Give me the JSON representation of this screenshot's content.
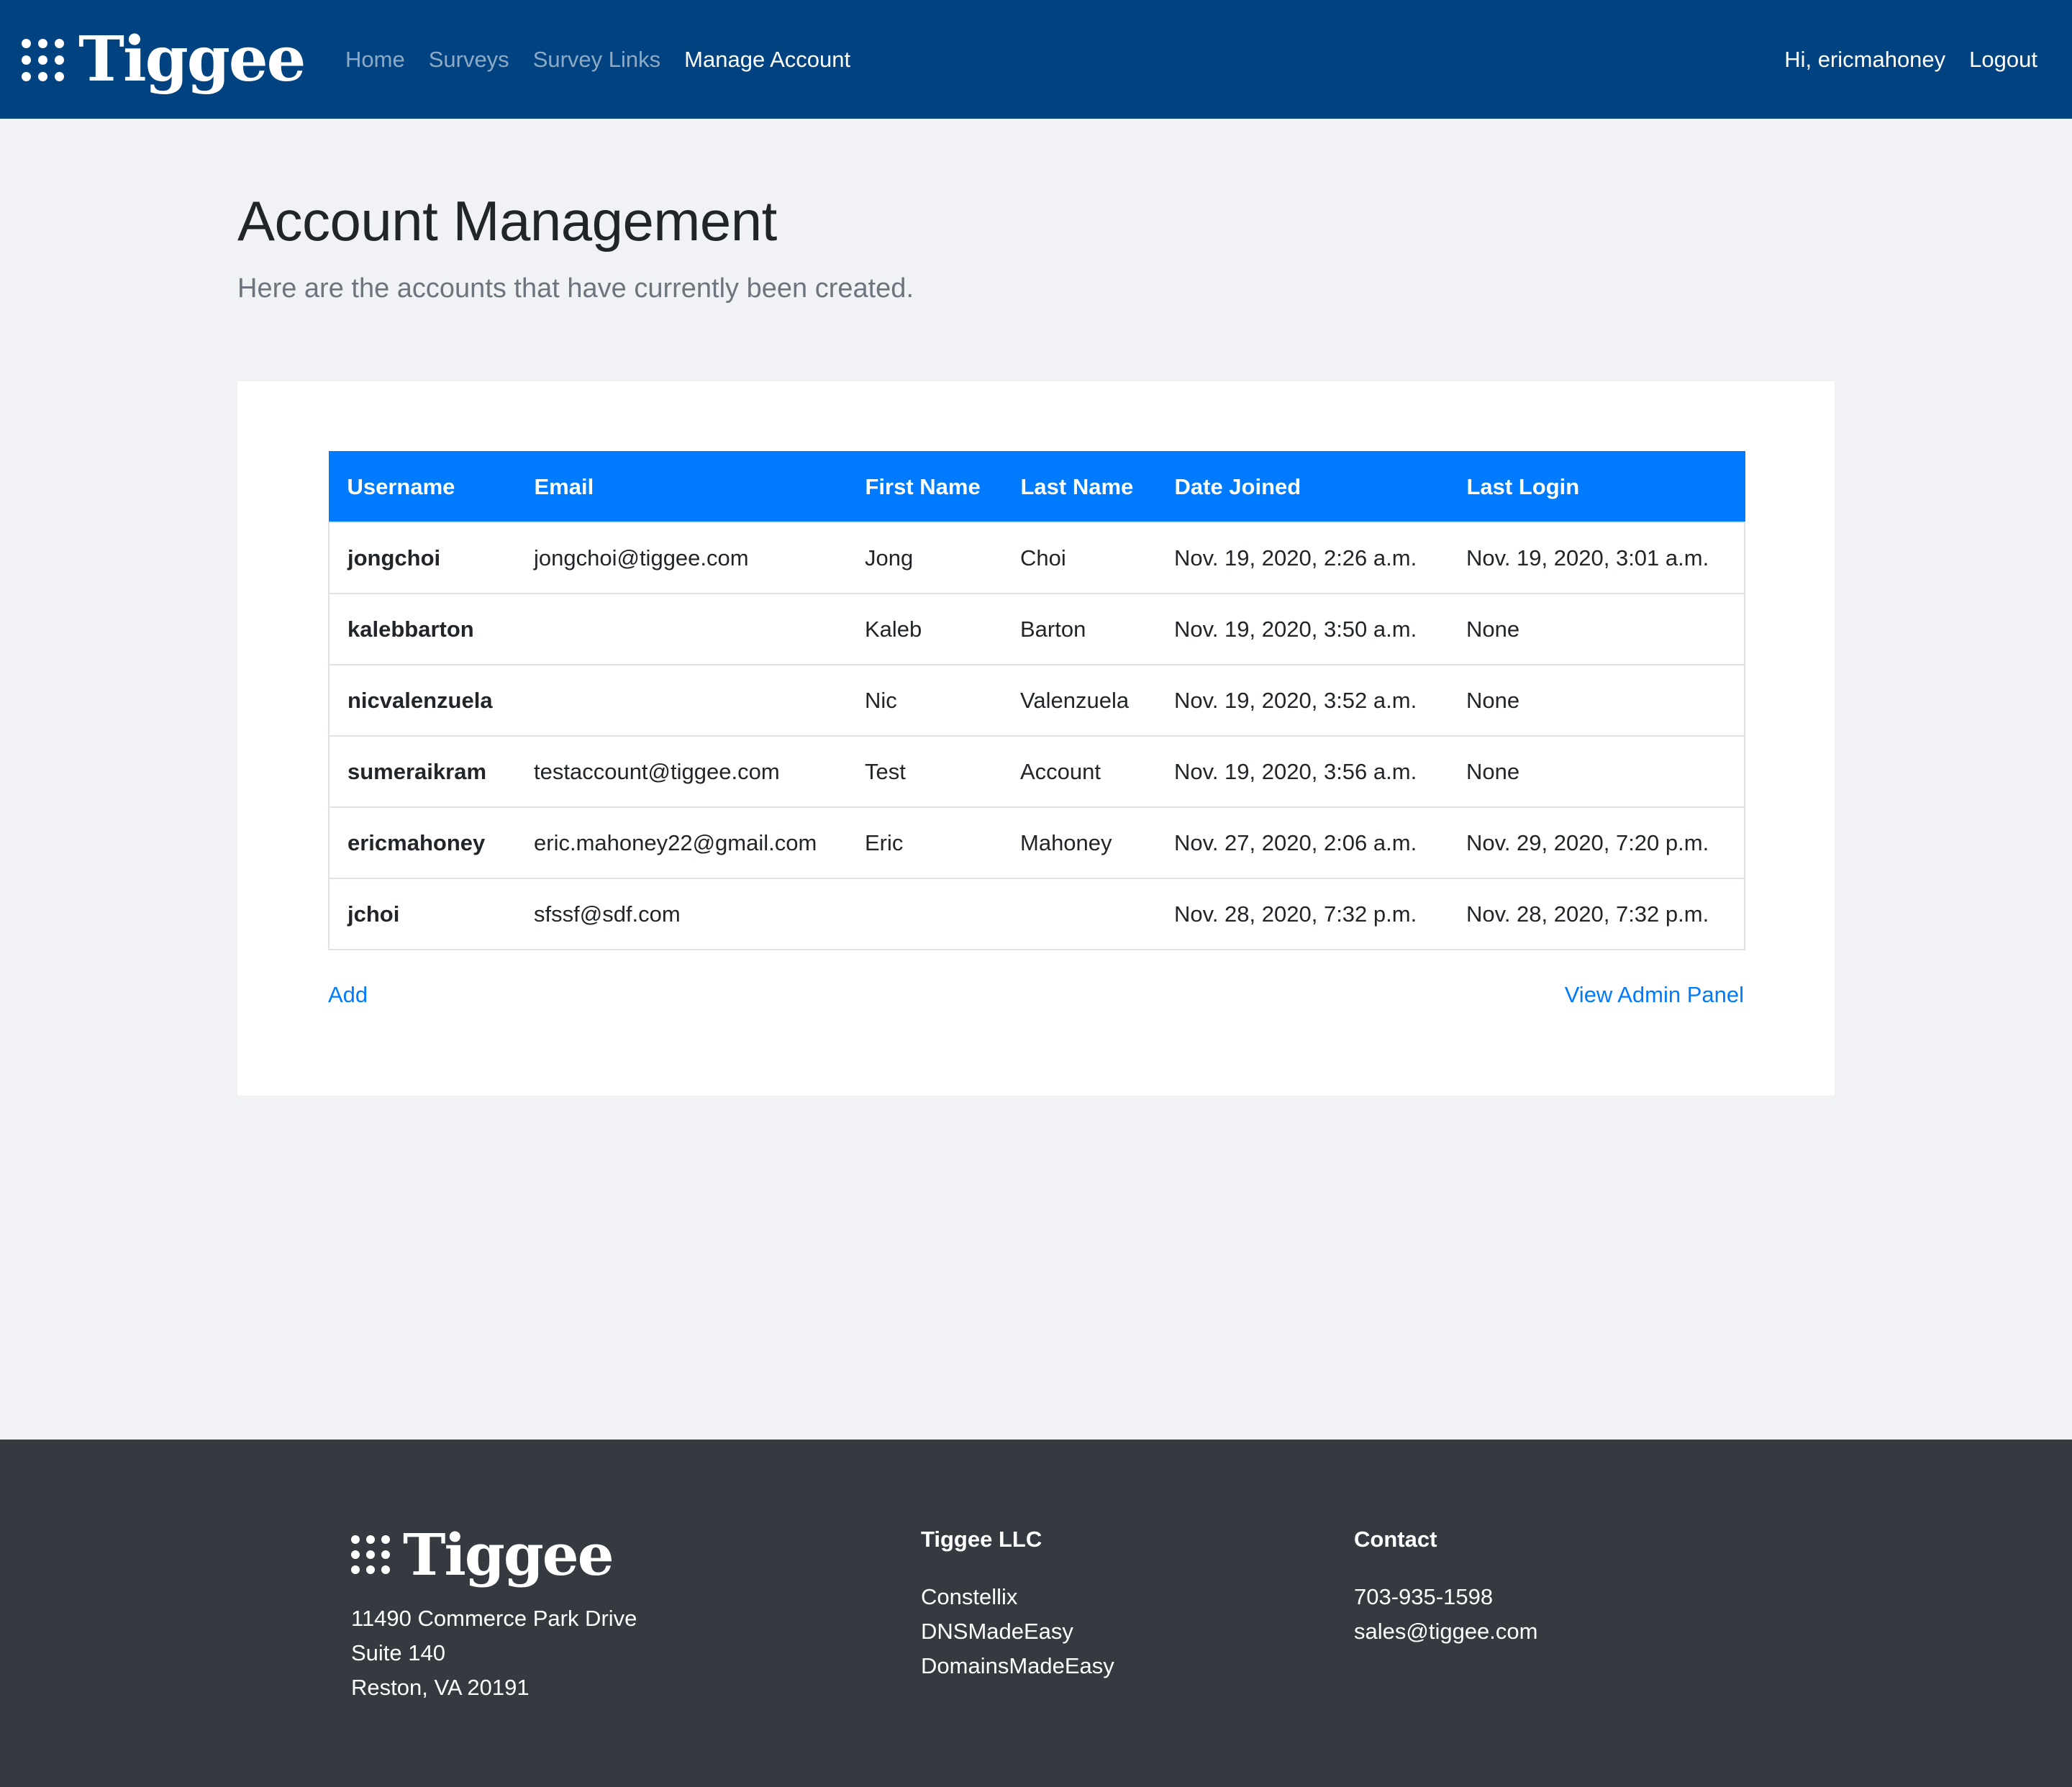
{
  "nav": {
    "brand": "Tiggee",
    "links": [
      {
        "label": "Home"
      },
      {
        "label": "Surveys"
      },
      {
        "label": "Survey Links"
      },
      {
        "label": "Manage Account"
      }
    ],
    "greeting": "Hi, ericmahoney",
    "logout": "Logout"
  },
  "header": {
    "title": "Account Management",
    "lead": "Here are the accounts that have currently been created."
  },
  "table": {
    "columns": [
      "Username",
      "Email",
      "First Name",
      "Last Name",
      "Date Joined",
      "Last Login"
    ],
    "rows": [
      [
        "jongchoi",
        "jongchoi@tiggee.com",
        "Jong",
        "Choi",
        "Nov. 19, 2020, 2:26 a.m.",
        "Nov. 19, 2020, 3:01 a.m."
      ],
      [
        "kalebbarton",
        "",
        "Kaleb",
        "Barton",
        "Nov. 19, 2020, 3:50 a.m.",
        "None"
      ],
      [
        "nicvalenzuela",
        "",
        "Nic",
        "Valenzuela",
        "Nov. 19, 2020, 3:52 a.m.",
        "None"
      ],
      [
        "sumeraikram",
        "testaccount@tiggee.com",
        "Test",
        "Account",
        "Nov. 19, 2020, 3:56 a.m.",
        "None"
      ],
      [
        "ericmahoney",
        "eric.mahoney22@gmail.com",
        "Eric",
        "Mahoney",
        "Nov. 27, 2020, 2:06 a.m.",
        "Nov. 29, 2020, 7:20 p.m."
      ],
      [
        "jchoi",
        "sfssf@sdf.com",
        "",
        "",
        "Nov. 28, 2020, 7:32 p.m.",
        "Nov. 28, 2020, 7:32 p.m."
      ]
    ]
  },
  "actions": {
    "add": "Add",
    "admin": "View Admin Panel"
  },
  "footer": {
    "brand": "Tiggee",
    "address": [
      "11490 Commerce Park Drive",
      "Suite 140",
      "Reston, VA 20191"
    ],
    "company": {
      "title": "Tiggee LLC",
      "items": [
        "Constellix",
        "DNSMadeEasy",
        "DomainsMadeEasy"
      ]
    },
    "contact": {
      "title": "Contact",
      "items": [
        "703-935-1598",
        "sales@tiggee.com"
      ]
    }
  },
  "colors": {
    "navbar": "#004380",
    "table_header": "#007bff",
    "link": "#007bff",
    "footer": "#343a40",
    "page_bg": "#f1f2f5"
  }
}
